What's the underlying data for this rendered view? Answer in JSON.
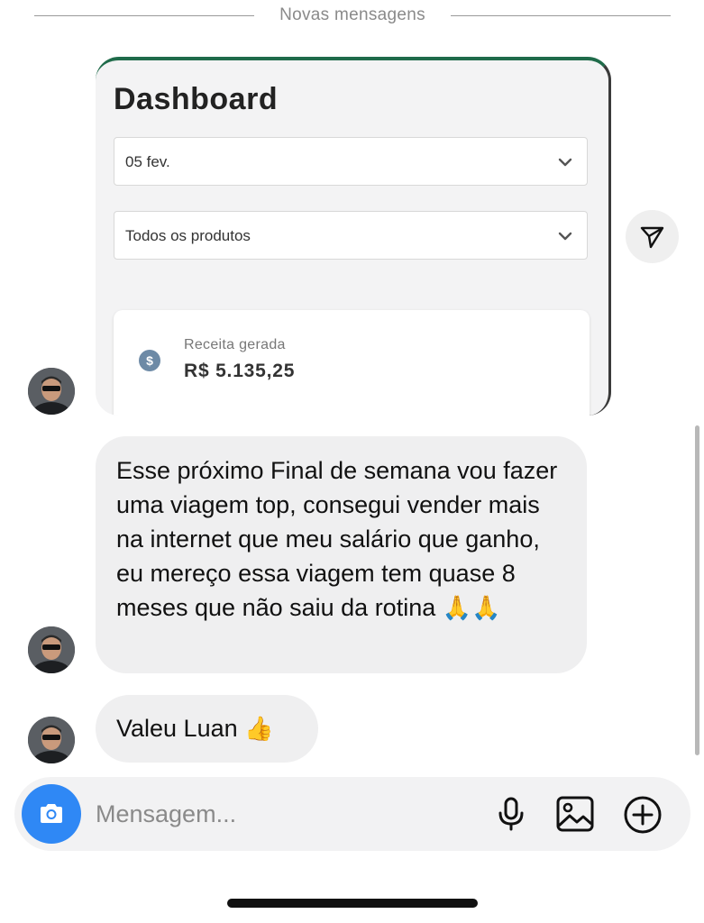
{
  "divider": {
    "label": "Novas mensagens"
  },
  "shared_image": {
    "title": "Dashboard",
    "date_select": "05 fev.",
    "product_select": "Todos os produtos",
    "revenue_label": "Receita gerada",
    "revenue_value": "R$  5.135,25",
    "revenue_icon": "dollar-coin-icon"
  },
  "messages": [
    {
      "text": "Esse próximo Final de semana vou fazer uma viagem top, consegui vender mais na internet que meu salário que ganho, eu mereço essa viagem tem quase 8 meses que não saiu da rotina",
      "emoji": "🙏🙏"
    },
    {
      "text": "Valeu Luan",
      "emoji": "👍"
    }
  ],
  "composer": {
    "placeholder": "Mensagem...",
    "icons": [
      "camera-icon",
      "microphone-icon",
      "gallery-icon",
      "plus-circle-icon"
    ]
  },
  "colors": {
    "camera_button": "#2f88f5",
    "bubble": "#efeff0",
    "dashboard_accent": "#1f6b4a"
  }
}
